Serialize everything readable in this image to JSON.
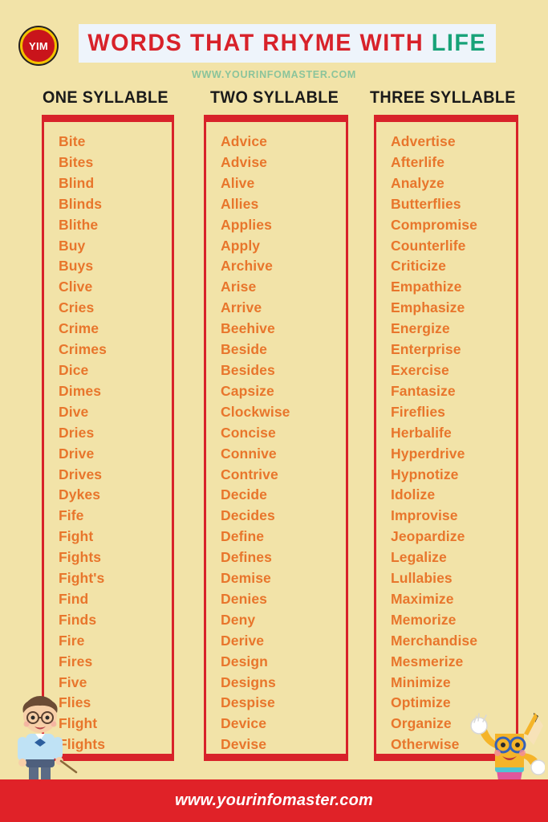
{
  "header": {
    "logo_text": "YIM",
    "logo_name": "yim-logo",
    "title_main": "WORDS THAT RHYME WITH ",
    "title_accent": "LIFE",
    "subtitle": "WWW.YOURINFOMASTER.COM"
  },
  "colors": {
    "background": "#f2e3a8",
    "title_red": "#d8222a",
    "title_teal": "#17a278",
    "word_orange": "#e8762c",
    "border_red": "#d8222a",
    "footer_red": "#e02228",
    "subtitle_green": "#8bc49b",
    "heading_black": "#1a1a1a",
    "title_band": "#eef4fb",
    "logo_gold": "#f2c200"
  },
  "columns": [
    {
      "heading": "ONE SYLLABLE",
      "words": [
        "Bite",
        "Bites",
        "Blind",
        "Blinds",
        "Blithe",
        "Buy",
        "Buys",
        "Clive",
        "Cries",
        "Crime",
        "Crimes",
        "Dice",
        "Dimes",
        "Dive",
        "Dries",
        "Drive",
        "Drives",
        "Dykes",
        "Fife",
        "Fight",
        "Fights",
        "Fight's",
        "Find",
        "Finds",
        "Fire",
        "Fires",
        "Five",
        "Flies",
        "Flight",
        "Flights"
      ]
    },
    {
      "heading": "TWO SYLLABLE",
      "words": [
        "Advice",
        "Advise",
        "Alive",
        "Allies",
        "Applies",
        "Apply",
        "Archive",
        "Arise",
        "Arrive",
        "Beehive",
        "Beside",
        "Besides",
        "Capsize",
        "Clockwise",
        "Concise",
        "Connive",
        "Contrive",
        "Decide",
        "Decides",
        "Define",
        "Defines",
        "Demise",
        "Denies",
        "Deny",
        "Derive",
        "Design",
        "Designs",
        "Despise",
        "Device",
        "Devise"
      ]
    },
    {
      "heading": "THREE SYLLABLE",
      "words": [
        "Advertise",
        "Afterlife",
        "Analyze",
        "Butterflies",
        "Compromise",
        "Counterlife",
        "Criticize",
        "Empathize",
        "Emphasize",
        "Energize",
        "Enterprise",
        "Exercise",
        "Fantasize",
        "Fireflies",
        "Herbalife",
        "Hyperdrive",
        "Hypnotize",
        "Idolize",
        "Improvise",
        "Jeopardize",
        "Legalize",
        "Lullabies",
        "Maximize",
        "Memorize",
        "Merchandise",
        "Mesmerize",
        "Minimize",
        "Optimize",
        "Organize",
        "Otherwise"
      ]
    }
  ],
  "footer": {
    "url": "www.yourinfomaster.com"
  },
  "mascots": {
    "left": "teacher-with-pointer-illustration",
    "right": "pencil-character-waving-illustration"
  }
}
